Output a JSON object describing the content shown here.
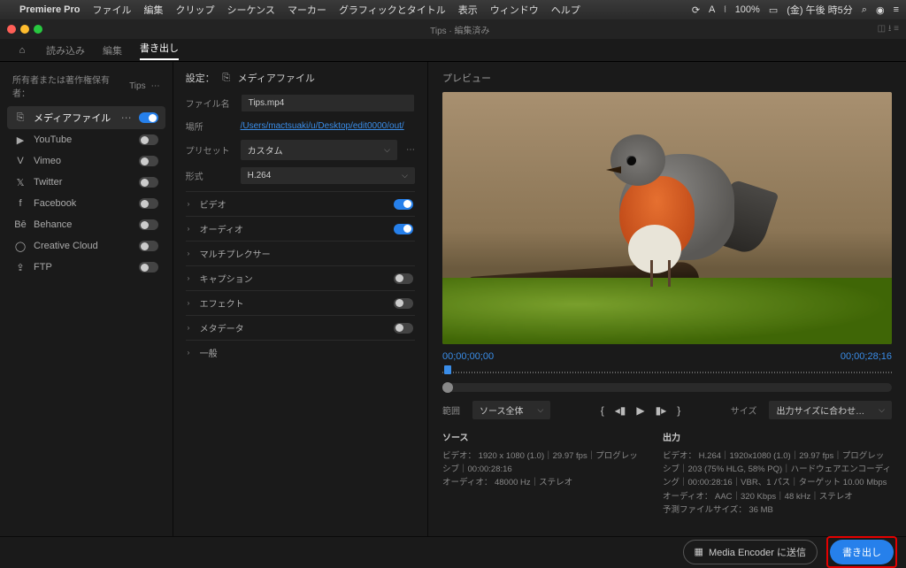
{
  "menubar": {
    "app": "Premiere Pro",
    "items": [
      "ファイル",
      "編集",
      "クリップ",
      "シーケンス",
      "マーカー",
      "グラフィックとタイトル",
      "表示",
      "ウィンドウ",
      "ヘルプ"
    ],
    "battery": "100%",
    "time": "(金) 午後 時5分"
  },
  "window": {
    "title": "Tips · 編集済み"
  },
  "tabs": {
    "t1": "読み込み",
    "t2": "編集",
    "t3": "書き出し"
  },
  "sidebar": {
    "header": "所有者または著作権保有者：",
    "project": "Tips",
    "dests": [
      {
        "label": "メディアファイル",
        "on": true,
        "active": true,
        "icon": "export"
      },
      {
        "label": "YouTube",
        "on": false,
        "icon": "youtube"
      },
      {
        "label": "Vimeo",
        "on": false,
        "icon": "vimeo"
      },
      {
        "label": "Twitter",
        "on": false,
        "icon": "twitter"
      },
      {
        "label": "Facebook",
        "on": false,
        "icon": "facebook"
      },
      {
        "label": "Behance",
        "on": false,
        "icon": "behance"
      },
      {
        "label": "Creative Cloud",
        "on": false,
        "icon": "cc"
      },
      {
        "label": "FTP",
        "on": false,
        "icon": "ftp"
      }
    ]
  },
  "settings": {
    "title": "設定：",
    "target": "メディアファイル",
    "filename_lbl": "ファイル名",
    "filename": "Tips.mp4",
    "location_lbl": "場所",
    "location": "/Users/mactsuaki/u/Desktop/edit0000/out/",
    "preset_lbl": "プリセット",
    "preset": "カスタム",
    "format_lbl": "形式",
    "format": "H.264",
    "sections": [
      {
        "label": "ビデオ",
        "toggle": true,
        "on": true
      },
      {
        "label": "オーディオ",
        "toggle": true,
        "on": true
      },
      {
        "label": "マルチプレクサー",
        "toggle": false
      },
      {
        "label": "キャプション",
        "toggle": true,
        "on": false
      },
      {
        "label": "エフェクト",
        "toggle": true,
        "on": false
      },
      {
        "label": "メタデータ",
        "toggle": true,
        "on": false
      },
      {
        "label": "一般",
        "toggle": false
      }
    ]
  },
  "preview": {
    "title": "プレビュー",
    "tc_in": "00;00;00;00",
    "tc_out": "00;00;28;16",
    "range_lbl": "範囲",
    "range": "ソース全体",
    "size_lbl": "サイズ",
    "size": "出力サイズに合わせ…",
    "source": {
      "title": "ソース",
      "video_lbl": "ビデオ：",
      "video": "1920 x 1080 (1.0)｜29.97 fps｜プログレッシブ｜00:00:28:16",
      "audio_lbl": "オーディオ：",
      "audio": "48000 Hz｜ステレオ"
    },
    "output": {
      "title": "出力",
      "video_lbl": "ビデオ：",
      "video": "H.264｜1920x1080 (1.0)｜29.97 fps｜プログレッシブ｜203 (75% HLG, 58% PQ)｜ハードウェアエンコーディング｜00:00:28:16｜VBR、1 パス｜ターゲット 10.00 Mbps",
      "audio_lbl": "オーディオ：",
      "audio": "AAC｜320 Kbps｜48 kHz｜ステレオ",
      "est_lbl": "予測ファイルサイズ：",
      "est": "36 MB"
    }
  },
  "footer": {
    "ame": "Media Encoder に送信",
    "export": "書き出し"
  }
}
